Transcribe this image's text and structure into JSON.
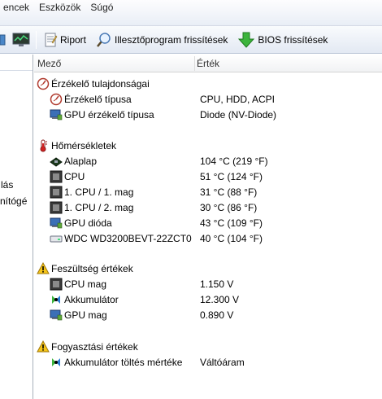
{
  "menu": [
    "encek",
    "Eszközök",
    "Súgó"
  ],
  "toolbar": {
    "report_label": "Riport",
    "driver_update_label": "Illesztőprogram frissítések",
    "bios_update_label": "BIOS frissítések"
  },
  "left_pane": {
    "fragments": [
      "lás",
      "nítógé"
    ]
  },
  "columns": {
    "field": "Mező",
    "value": "Érték"
  },
  "sections": [
    {
      "title": "Érzékelő tulajdonságai",
      "icon": "sensor-gauge-icon",
      "items": [
        {
          "name": "Érzékelő típusa",
          "value": "CPU, HDD, ACPI",
          "icon": "sensor-gauge-icon"
        },
        {
          "name": "GPU érzékelő típusa",
          "value": "Diode  (NV-Diode)",
          "icon": "monitor-icon"
        }
      ]
    },
    {
      "title": "Hőmérsékletek",
      "icon": "thermometer-icon",
      "items": [
        {
          "name": "Alaplap",
          "value": "104 °C  (219 °F)",
          "icon": "motherboard-icon"
        },
        {
          "name": "CPU",
          "value": "51 °C  (124 °F)",
          "icon": "cpu-chip-icon"
        },
        {
          "name": "1. CPU / 1. mag",
          "value": "31 °C  (88 °F)",
          "icon": "cpu-chip-icon"
        },
        {
          "name": "1. CPU / 2. mag",
          "value": "30 °C  (86 °F)",
          "icon": "cpu-chip-icon"
        },
        {
          "name": "GPU dióda",
          "value": "43 °C  (109 °F)",
          "icon": "monitor-icon"
        },
        {
          "name": "WDC WD3200BEVT-22ZCT0",
          "value": "40 °C  (104 °F)",
          "icon": "hard-drive-icon"
        }
      ]
    },
    {
      "title": "Feszültség értékek",
      "icon": "warning-icon",
      "items": [
        {
          "name": "CPU mag",
          "value": "1.150 V",
          "icon": "cpu-chip-icon"
        },
        {
          "name": "Akkumulátor",
          "value": "12.300 V",
          "icon": "battery-icon"
        },
        {
          "name": "GPU mag",
          "value": "0.890 V",
          "icon": "monitor-icon"
        }
      ]
    },
    {
      "title": "Fogyasztási értékek",
      "icon": "warning-icon",
      "items": [
        {
          "name": "Akkumulátor töltés mértéke",
          "value": "Váltóáram",
          "icon": "battery-icon"
        }
      ]
    }
  ]
}
